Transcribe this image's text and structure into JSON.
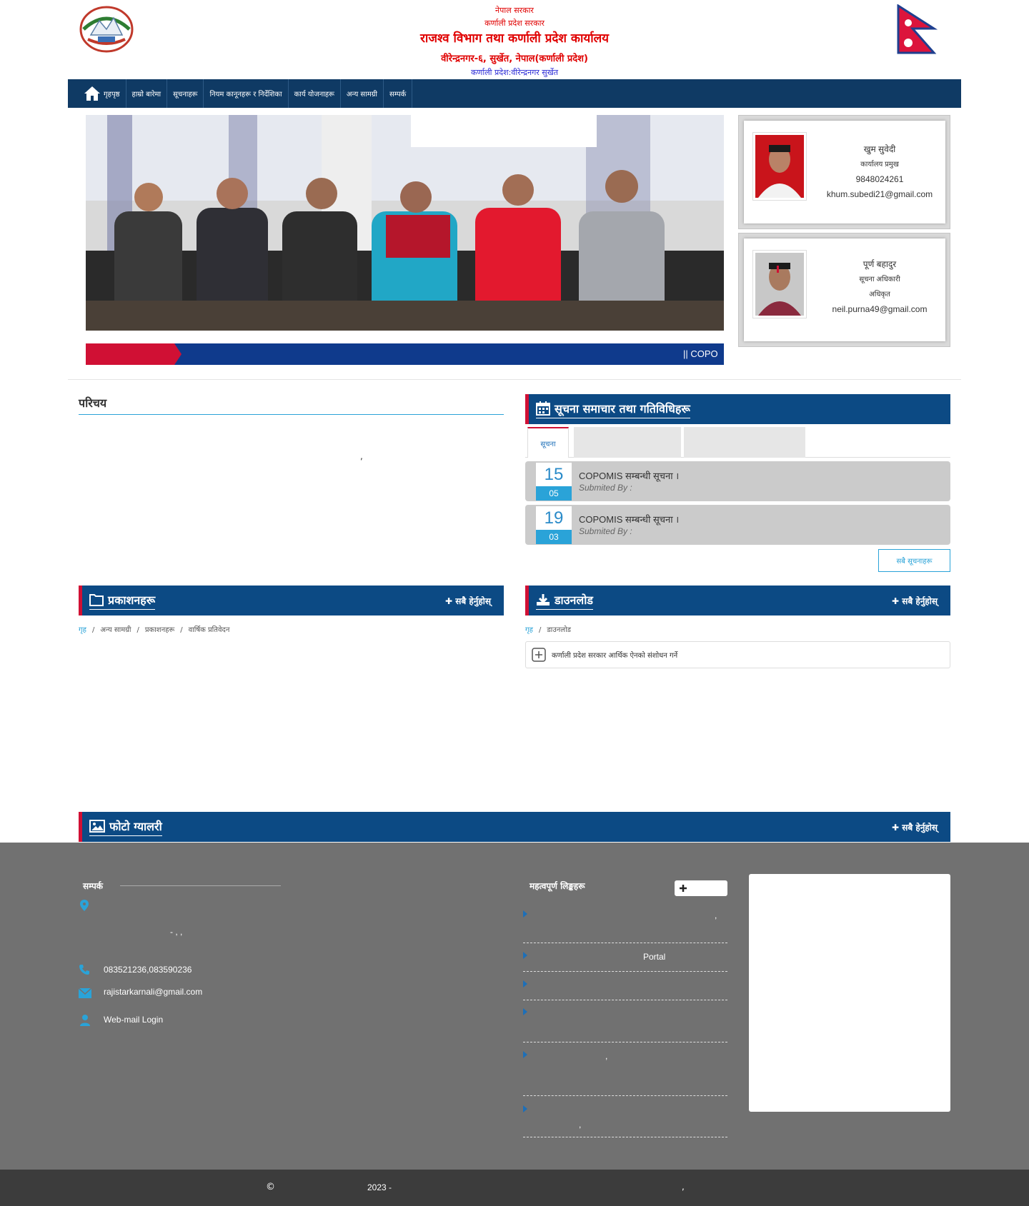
{
  "header": {
    "line1": "नेपाल सरकार",
    "line2": "कर्णाली प्रदेश सरकार",
    "title": "राजश्व विभाग तथा कर्णाली प्रदेश कार्यालय",
    "address": "वीरेन्द्रनगर-६, सुर्खेत, नेपाल(कर्णाली प्रदेश)",
    "subtitle": "कर्णाली प्रदेश:वीरेन्द्रनगर सुर्खेत"
  },
  "nav": {
    "items": [
      "गृहपृष्ठ",
      "हाम्रो बारेमा",
      "सूचनाहरू",
      "नियम कानूनहरू र निर्देशिका",
      "कार्य योजनाहरू",
      "अन्य सामग्री",
      "सम्पर्क"
    ]
  },
  "ticker": {
    "label": "",
    "text": "|| COPO"
  },
  "officials": [
    {
      "name": "खुम सुवेदी",
      "role": "कार्यालय प्रमुख",
      "phone": "9848024261",
      "email": "khum.subedi21@gmail.com"
    },
    {
      "name": "पूर्ण बहादुर",
      "role": "सूचना अधिकारी",
      "role2": "अधिकृत",
      "email": "neil.purna49@gmail.com"
    }
  ],
  "intro": {
    "title": "परिचय",
    "comma": ","
  },
  "news": {
    "title": "सूचना समाचार तथा गतिविधिहरू",
    "tabs": [
      "सूचना",
      "",
      ""
    ],
    "items": [
      {
        "day": "15",
        "month": "05",
        "title": "COPOMIS सम्बन्धी सूचना ।",
        "by": "Submited By :"
      },
      {
        "day": "19",
        "month": "03",
        "title": "COPOMIS सम्बन्धी सूचना ।",
        "by": "Submited By :"
      }
    ],
    "more": "सबै सूचनाहरू"
  },
  "documents": {
    "title": "प्रकाशनहरू",
    "more": "✚ सबै हेर्नुहोस्",
    "crumbs": [
      "गृह",
      "अन्य सामग्री",
      "प्रकाशनहरू",
      "वार्षिक प्रतिवेदन"
    ]
  },
  "downloads": {
    "title": "डाउनलोड",
    "more": "✚ सबै हेर्नुहोस्",
    "crumbs": [
      "गृह",
      "डाउनलोड"
    ],
    "item": "कर्णाली प्रदेश सरकार आर्थिक ऐनको संशोधन गर्ने"
  },
  "gallery": {
    "title": "फोटो ग्यालरी",
    "more": "✚ सबै हेर्नुहोस्"
  },
  "footer": {
    "contact_title": "सम्पर्क",
    "address_line": "- ,        ,",
    "phone": "083521236,083590236",
    "email": "rajistarkarnali@gmail.com",
    "webmail": "Web-mail Login",
    "links_title": "महत्वपूर्ण लिङ्कहरू",
    "links": [
      ",",
      "Portal",
      "",
      "",
      ",",
      ","
    ],
    "copyright_symbol": "©",
    "year": "2023 -",
    "copyright_comma": ","
  },
  "colors": {
    "nav_bg": "#0f3a64",
    "bar_bg": "#0c4a84",
    "accent_red": "#d01034",
    "accent_blue": "#2aa3d8",
    "footer_bg": "#717171",
    "copyright_bg": "#3c3c3c"
  }
}
